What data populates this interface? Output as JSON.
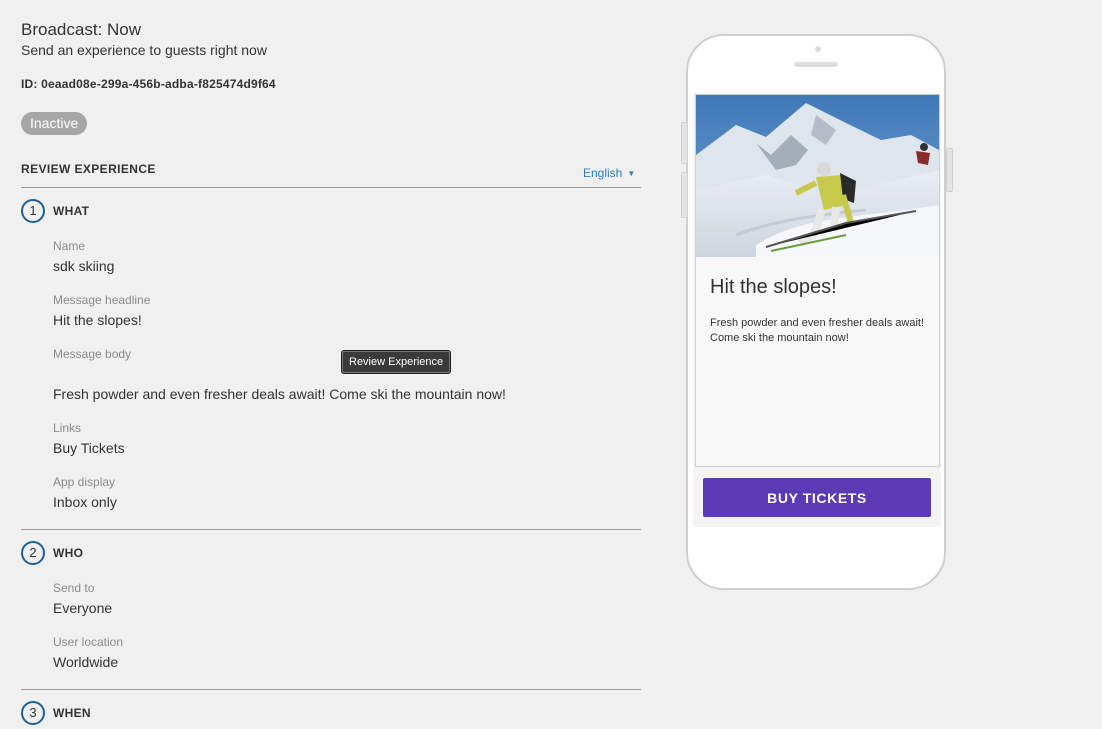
{
  "header": {
    "title": "Broadcast: Now",
    "subtitle": "Send an experience to guests right now",
    "id_label": "ID: 0eaad08e-299a-456b-adba-f825474d9f64",
    "status": "Inactive"
  },
  "review": {
    "heading": "REVIEW EXPERIENCE",
    "language": "English"
  },
  "steps": [
    {
      "number": "1",
      "label": "WHAT",
      "fields": [
        {
          "label": "Name",
          "value": "sdk skiing"
        },
        {
          "label": "Message headline",
          "value": "Hit the slopes!"
        },
        {
          "label": "Message body",
          "value": "Fresh powder and even fresher deals await! Come ski the mountain now!"
        },
        {
          "label": "Links",
          "value": "Buy Tickets"
        },
        {
          "label": "App display",
          "value": "Inbox only"
        }
      ]
    },
    {
      "number": "2",
      "label": "WHO",
      "fields": [
        {
          "label": "Send to",
          "value": "Everyone"
        },
        {
          "label": "User location",
          "value": "Worldwide"
        }
      ]
    },
    {
      "number": "3",
      "label": "WHEN",
      "fields": []
    }
  ],
  "tooltip": "Review Experience",
  "preview": {
    "headline": "Hit the slopes!",
    "body": "Fresh powder and even fresher deals await! Come ski the mountain now!",
    "cta": "BUY TICKETS",
    "image_icon": "skier-photo"
  },
  "colors": {
    "accent": "#5d3ab5",
    "link": "#2b7bbd",
    "step_ring": "#1f5f95",
    "status_bg": "#a6a6a6"
  }
}
